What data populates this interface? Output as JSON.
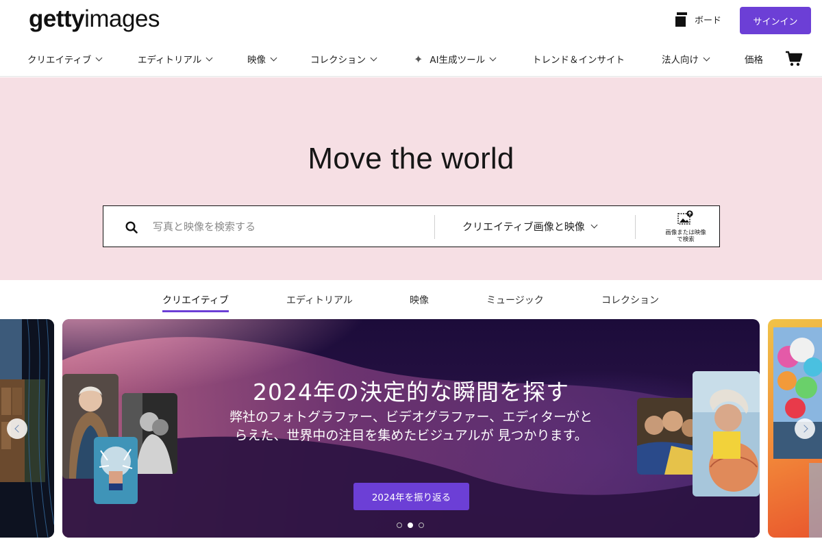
{
  "header": {
    "logo_bold": "getty",
    "logo_thin": "images",
    "board_label": "ボード",
    "signin_label": "サインイン"
  },
  "nav": {
    "items": [
      {
        "label": "クリエイティブ",
        "has_chevron": true
      },
      {
        "label": "エディトリアル",
        "has_chevron": true
      },
      {
        "label": "映像",
        "has_chevron": true
      },
      {
        "label": "コレクション",
        "has_chevron": true
      },
      {
        "label": "AI生成ツール",
        "has_chevron": true,
        "icon": "sparkle-icon"
      },
      {
        "label": "トレンド＆インサイト",
        "has_chevron": false
      },
      {
        "label": "法人向け",
        "has_chevron": true
      },
      {
        "label": "価格",
        "has_chevron": false
      }
    ],
    "cart_icon": "cart-icon"
  },
  "hero": {
    "title": "Move the world",
    "search": {
      "placeholder": "写真と映像を検索する",
      "filter_label": "クリエイティブ画像と映像",
      "image_search_label_1": "画像または映像",
      "image_search_label_2": "で検索"
    }
  },
  "tabs": {
    "items": [
      {
        "label": "クリエイティブ",
        "active": true
      },
      {
        "label": "エディトリアル",
        "active": false
      },
      {
        "label": "映像",
        "active": false
      },
      {
        "label": "ミュージック",
        "active": false
      },
      {
        "label": "コレクション",
        "active": false
      }
    ]
  },
  "carousel": {
    "slide_title": "2024年の決定的な瞬間を探す",
    "slide_desc_line1": "弊社のフォトグラファー、ビデオグラファー、エディターがと",
    "slide_desc_line2": "らえた、世界中の注目を集めたビジュアルが 見つかります。",
    "cta_label": "2024年を振り返る",
    "dots_total": 3,
    "dots_active_index": 1
  },
  "colors": {
    "accent": "#6c3fd6",
    "hero_bg": "#f6dfe4",
    "card_bg": "#1c0c3a"
  }
}
